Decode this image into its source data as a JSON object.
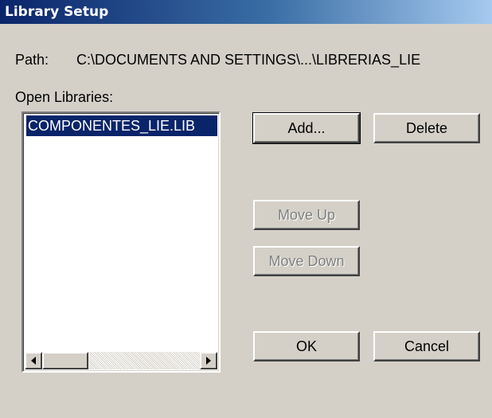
{
  "window": {
    "title": "Library Setup"
  },
  "path": {
    "label": "Path:",
    "value": "C:\\DOCUMENTS AND SETTINGS\\...\\LIBRERIAS_LIE"
  },
  "libraries": {
    "label": "Open Libraries:",
    "items": [
      "COMPONENTES_LIE.LIB"
    ],
    "selected_index": 0
  },
  "buttons": {
    "add": "Add...",
    "delete": "Delete",
    "move_up": "Move Up",
    "move_down": "Move Down",
    "ok": "OK",
    "cancel": "Cancel"
  },
  "colors": {
    "dialog_bg": "#d4d0c8",
    "title_gradient_start": "#0a246a",
    "title_gradient_end": "#a6caf0",
    "selection": "#0a246a",
    "disabled_text": "#808080"
  },
  "icons": {
    "scroll_left": "arrow-left-icon",
    "scroll_right": "arrow-right-icon"
  }
}
